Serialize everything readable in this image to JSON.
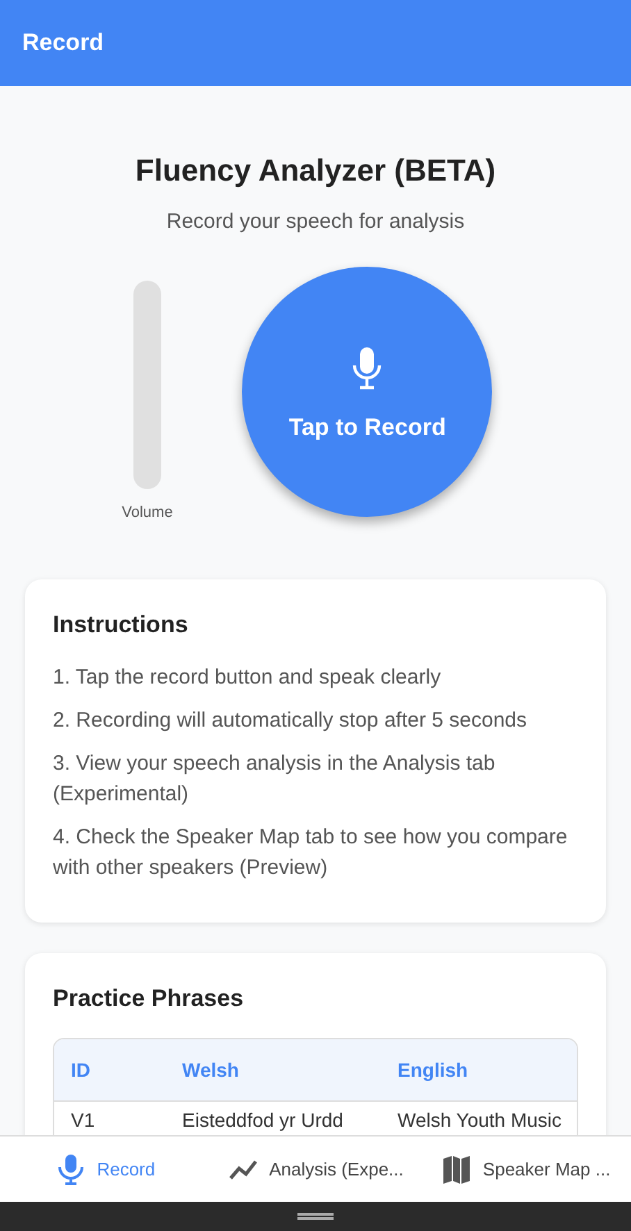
{
  "app_bar": {
    "title": "Record"
  },
  "header": {
    "title": "Fluency Analyzer (BETA)",
    "subtitle": "Record your speech for analysis"
  },
  "volume": {
    "label": "Volume",
    "level": 0
  },
  "record_button": {
    "label": "Tap to Record"
  },
  "instructions": {
    "title": "Instructions",
    "items": [
      "1. Tap the record button and speak clearly",
      "2. Recording will automatically stop after 5 seconds",
      "3. View your speech analysis in the Analysis tab (Experimental)",
      "4. Check the Speaker Map tab to see how you compare with other speakers (Preview)"
    ]
  },
  "practice": {
    "title": "Practice Phrases",
    "columns": [
      "ID",
      "Welsh",
      "English"
    ],
    "rows": [
      [
        "V1",
        "Eisteddfod yr Urdd",
        "Welsh Youth Music"
      ]
    ]
  },
  "tabs": [
    {
      "label": "Record",
      "selected": true
    },
    {
      "label": "Analysis (Expe...",
      "selected": false
    },
    {
      "label": "Speaker Map ...",
      "selected": false
    }
  ]
}
